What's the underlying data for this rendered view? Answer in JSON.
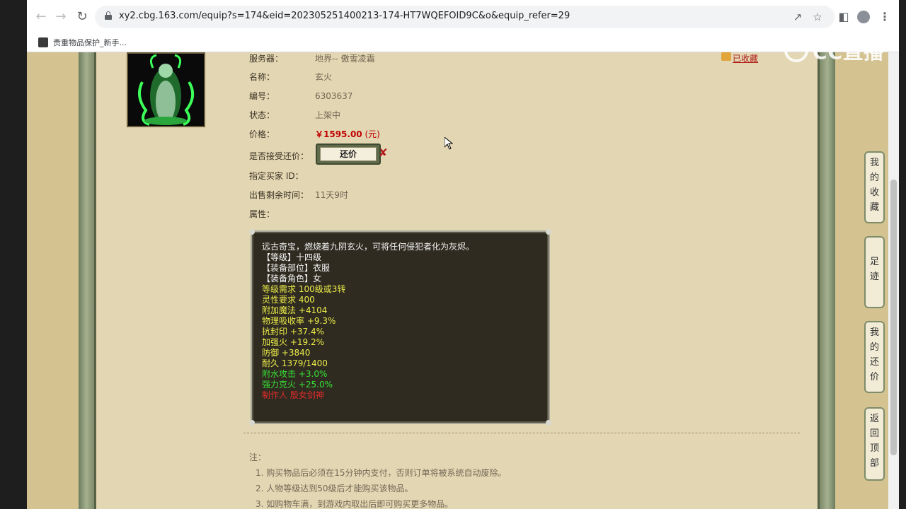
{
  "browser": {
    "url": "xy2.cbg.163.com/equip?s=174&eid=202305251400213-174-HT7WQEFOID9C&o&equip_refer=29",
    "bookmark_label": "贵重物品保护_新手..."
  },
  "watermark": {
    "text": "CC直播"
  },
  "header": {
    "favorites_label": "已收藏"
  },
  "equip": {
    "fields": [
      {
        "label": "服务器：",
        "value": "地界-- 傲雪凌霜"
      },
      {
        "label": "名称：",
        "value": "玄火"
      },
      {
        "label": "编号：",
        "value": "6303637"
      },
      {
        "label": "状态：",
        "value": "上架中"
      }
    ],
    "price_label": "价格：",
    "price_value": "￥1595.00",
    "price_unit": "(元)",
    "bargain_label": "是否接受还价：",
    "bargain_button": "还价",
    "buyer_label": "指定买家 ID：",
    "time_label": "出售剩余时间：",
    "time_value": "11天9时",
    "attrs_label": "属性："
  },
  "stats": [
    {
      "text": "远古奇宝，燃烧着九阴玄火，可将任何侵犯者化为灰烬。",
      "color": "white"
    },
    {
      "text": "【等级】十四级",
      "color": "white"
    },
    {
      "text": "【装备部位】衣服",
      "color": "white"
    },
    {
      "text": "【装备角色】女",
      "color": "white"
    },
    {
      "text": "等级需求 100级或3转",
      "color": "yellow"
    },
    {
      "text": "灵性要求 400",
      "color": "yellow"
    },
    {
      "text": "附加魔法 +4104",
      "color": "yellow"
    },
    {
      "text": "物理吸收率 +9.3%",
      "color": "yellow"
    },
    {
      "text": "抗封印 +37.4%",
      "color": "yellow"
    },
    {
      "text": "加强火 +19.2%",
      "color": "yellow"
    },
    {
      "text": "防御 +3840",
      "color": "yellow"
    },
    {
      "text": "耐久 1379/1400",
      "color": "yellow"
    },
    {
      "text": "附水攻击 +3.0%",
      "color": "green"
    },
    {
      "text": "强力克火 +25.0%",
      "color": "green"
    },
    {
      "text": "制作人 殷女剑神",
      "color": "red"
    }
  ],
  "notes": {
    "title": "注：",
    "items": [
      "1. 购买物品后必须在15分钟内支付，否则订单将被系统自动废除。",
      "2. 人物等级达到50级后才能购买该物品。",
      "3. 如购物车满，到游戏内取出后即可购买更多物品。"
    ]
  },
  "side_tabs": [
    {
      "label": "我的收藏"
    },
    {
      "label": "足迹"
    },
    {
      "label": "我的还价"
    },
    {
      "label": "返回顶部"
    }
  ],
  "colors": {
    "stat_white": "#f5f5f5",
    "stat_yellow": "#eded4a",
    "stat_green": "#36e036",
    "stat_red": "#e02a2a",
    "price": "#c00000"
  }
}
